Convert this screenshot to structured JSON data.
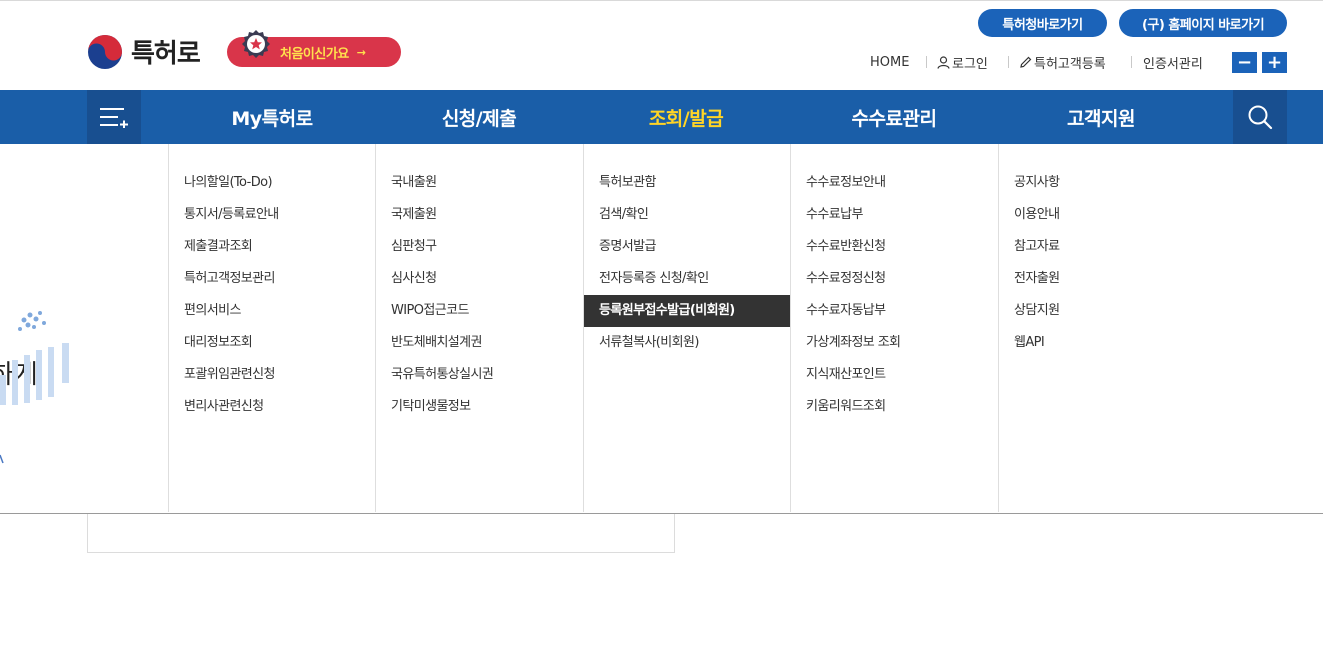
{
  "header": {
    "logo_text": "특허로",
    "first_visit_label": "처음이신가요",
    "first_visit_arrow": "→",
    "quick_links": [
      "특허청바로가기",
      "(구) 홈페이지 바로가기"
    ],
    "util": {
      "home": "HOME",
      "login": "로그인",
      "register": "특허고객등록",
      "cert": "인증서관리",
      "font_minus": "−",
      "font_plus": "+"
    },
    "icons": {
      "user": "person-icon",
      "pencil": "pencil-icon"
    }
  },
  "gnb": {
    "tabs": [
      {
        "label": "My특허로",
        "active": false
      },
      {
        "label": "신청/제출",
        "active": false
      },
      {
        "label": "조회/발급",
        "active": true
      },
      {
        "label": "수수료관리",
        "active": false
      },
      {
        "label": "고객지원",
        "active": false
      }
    ],
    "colors": {
      "bar": "#1a5ea8",
      "active_text": "#ffd426",
      "side_button": "#184f90"
    }
  },
  "background": {
    "heading_fragment": "하게"
  },
  "mega_menu": {
    "columns": [
      {
        "items": [
          "나의할일(To-Do)",
          "통지서/등록료안내",
          "제출결과조회",
          "특허고객정보관리",
          "편의서비스",
          "대리정보조회",
          "포괄위임관련신청",
          "변리사관련신청"
        ]
      },
      {
        "items": [
          "국내출원",
          "국제출원",
          "심판청구",
          "심사신청",
          "WIPO접근코드",
          "반도체배치설계권",
          "국유특허통상실시권",
          "기탁미생물정보"
        ]
      },
      {
        "items": [
          "특허보관함",
          "검색/확인",
          "증명서발급",
          "전자등록증 신청/확인",
          "등록원부접수발급(비회원)",
          "서류철복사(비회원)"
        ],
        "highlighted_index": 4
      },
      {
        "items": [
          "수수료정보안내",
          "수수료납부",
          "수수료반환신청",
          "수수료정정신청",
          "수수료자동납부",
          "가상계좌정보 조회",
          "지식재산포인트",
          "키움리워드조회"
        ]
      },
      {
        "items": [
          "공지사항",
          "이용안내",
          "참고자료",
          "전자출원",
          "상담지원",
          "웹API"
        ]
      }
    ]
  }
}
